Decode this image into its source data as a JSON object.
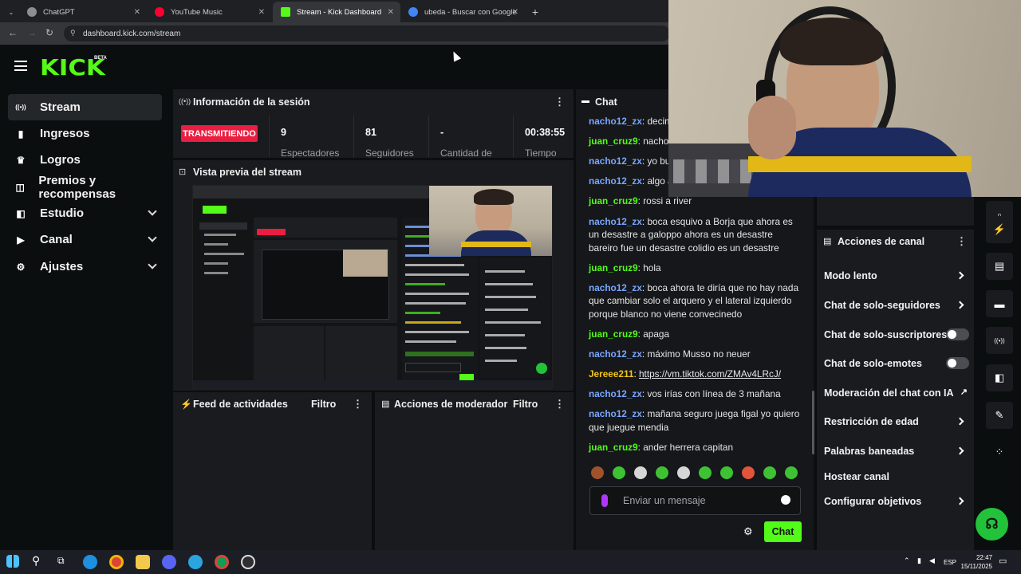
{
  "browser": {
    "tabs": [
      {
        "title": "ChatGPT",
        "active": false,
        "color": "#8e8e8e"
      },
      {
        "title": "YouTube Music",
        "active": false,
        "color": "#ff0033"
      },
      {
        "title": "Stream - Kick Dashboard",
        "active": true,
        "color": "#53fc18"
      },
      {
        "title": "ubeda - Buscar con Google",
        "active": false,
        "color": "#4285f4"
      }
    ],
    "url": "dashboard.kick.com/stream"
  },
  "header": {
    "logo": "KICK",
    "badge": "BETA"
  },
  "sidebar": {
    "items": [
      {
        "label": "Stream",
        "icon": "broadcast-icon",
        "glyph": "((•))",
        "active": true,
        "expandable": false
      },
      {
        "label": "Ingresos",
        "icon": "chart-icon",
        "glyph": "▮",
        "active": false,
        "expandable": false
      },
      {
        "label": "Logros",
        "icon": "trophy-icon",
        "glyph": "🏆",
        "active": false,
        "expandable": false
      },
      {
        "label": "Premios y recompensas",
        "icon": "gift-icon",
        "glyph": "◫",
        "active": false,
        "expandable": false
      },
      {
        "label": "Estudio",
        "icon": "studio-icon",
        "glyph": "◧",
        "active": false,
        "expandable": true
      },
      {
        "label": "Canal",
        "icon": "channel-icon",
        "glyph": "▶",
        "active": false,
        "expandable": true
      },
      {
        "label": "Ajustes",
        "icon": "gear-icon",
        "glyph": "⚙",
        "active": false,
        "expandable": true
      }
    ]
  },
  "session": {
    "title": "Información de la sesión",
    "status": "TRANSMITIENDO",
    "stats": [
      {
        "value": "9",
        "label": "Espectadores"
      },
      {
        "value": "81",
        "label": "Seguidores"
      },
      {
        "value": "-",
        "label": "Cantidad de"
      },
      {
        "value": "00:38:55",
        "label": "Tiempo"
      }
    ]
  },
  "preview": {
    "title": "Vista previa del stream"
  },
  "activity": {
    "title": "Feed de actividades",
    "filter": "Filtro"
  },
  "modactions": {
    "title": "Acciones de moderador",
    "filter": "Filtro"
  },
  "chat": {
    "title": "Chat",
    "messages": [
      {
        "user": "nacho12_zx",
        "text": "decime",
        "color": "#7aa7ff",
        "lines": 1
      },
      {
        "user": "juan_cruz9",
        "text": "nacho",
        "color": "#53fc18",
        "lines": 1
      },
      {
        "user": "nacho12_zx",
        "text": "yo bus",
        "color": "#7aa7ff",
        "lines": 1
      },
      {
        "user": "nacho12_zx",
        "text": "algo as",
        "color": "#7aa7ff",
        "lines": 1
      },
      {
        "user": "juan_cruz9",
        "text": "rossi a river",
        "color": "#53fc18",
        "lines": 1
      },
      {
        "user": "nacho12_zx",
        "text": "boca esquivo a Borja que ahora es un desastre a galoppo ahora es un desastre bareiro fue un desastre colidio es un desastre",
        "color": "#7aa7ff",
        "lines": 3
      },
      {
        "user": "juan_cruz9",
        "text": "hola",
        "color": "#53fc18",
        "lines": 1
      },
      {
        "user": "nacho12_zx",
        "text": "boca ahora te diría que no hay nada que cambiar solo el arquero y el lateral izquierdo porque blanco no viene convecinedo",
        "color": "#7aa7ff",
        "lines": 3
      },
      {
        "user": "juan_cruz9",
        "text": "apaga",
        "color": "#53fc18",
        "lines": 1
      },
      {
        "user": "nacho12_zx",
        "text": "máximo Musso no neuer",
        "color": "#7aa7ff",
        "lines": 1
      },
      {
        "user": "Jereee211",
        "text": "https://vm.tiktok.com/ZMAv4LRcJ/",
        "color": "#f5c518",
        "lines": 1,
        "link": true
      },
      {
        "user": "nacho12_zx",
        "text": "vos irías con línea de 3 mañana",
        "color": "#7aa7ff",
        "lines": 1
      },
      {
        "user": "nacho12_zx",
        "text": "mañana seguro juega figal yo quiero que juegue mendia",
        "color": "#7aa7ff",
        "lines": 2
      },
      {
        "user": "juan_cruz9",
        "text": "ander herrera capitan",
        "color": "#53fc18",
        "lines": 1
      }
    ],
    "input_placeholder": "Enviar un mensaje",
    "send_label": "Chat"
  },
  "channel_actions": {
    "title": "Acciones de canal",
    "items": [
      {
        "label": "Modo lento",
        "control": "chevron"
      },
      {
        "label": "Chat de solo-seguidores",
        "control": "chevron"
      },
      {
        "label": "Chat de solo-suscriptores",
        "control": "toggle"
      },
      {
        "label": "Chat de solo-emotes",
        "control": "toggle"
      },
      {
        "label": "Moderación del chat con IA",
        "control": "external"
      },
      {
        "label": "Restricción de edad",
        "control": "chevron"
      },
      {
        "label": "Palabras baneadas",
        "control": "chevron"
      },
      {
        "label": "Hostear canal",
        "control": "none"
      },
      {
        "label": "Configurar objetivos",
        "control": "chevron"
      }
    ]
  },
  "taskbar": {
    "lang": "ESP",
    "time": "22:47",
    "date": "15/11/2025"
  }
}
